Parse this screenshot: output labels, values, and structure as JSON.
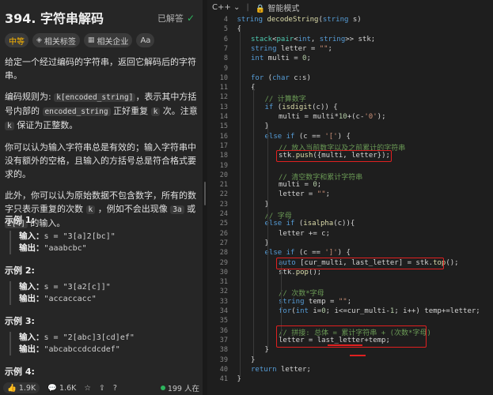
{
  "problem": {
    "title": "394. 字符串解码",
    "solved_label": "已解答",
    "tags": [
      {
        "label": "中等"
      },
      {
        "label": "相关标签"
      },
      {
        "label": "相关企业"
      },
      {
        "label": "Aa"
      }
    ],
    "desc_1": "给定一个经过编码的字符串，返回它解码后的字符串。",
    "desc_2a": "编码规则为: ",
    "desc_2b": "k[encoded_string]",
    "desc_2c": "，表示其中方括号内部的 ",
    "desc_2d": "encoded_string",
    "desc_2e": " 正好重复 ",
    "desc_2f": "k",
    "desc_2g": " 次。注意 ",
    "desc_2h": "k",
    "desc_2i": " 保证为正整数。",
    "desc_3": "你可以认为输入字符串总是有效的；输入字符串中没有额外的空格，且输入的方括号总是符合格式要求的。",
    "desc_4a": "此外，你可以认为原始数据不包含数字，所有的数字只表示重复的次数 ",
    "desc_4b": "k",
    "desc_4c": " ，例如不会出现像 ",
    "desc_4d": "3a",
    "desc_4e": " 或 ",
    "desc_4f": "2[4]",
    "desc_4g": " 的输入。",
    "examples": [
      {
        "title": "示例 1:",
        "input_label": "输入：",
        "input": "s = \"3[a]2[bc]\"",
        "output_label": "输出：",
        "output": "\"aaabcbc\""
      },
      {
        "title": "示例 2:",
        "input_label": "输入：",
        "input": "s = \"3[a2[c]]\"",
        "output_label": "输出：",
        "output": "\"accaccacc\""
      },
      {
        "title": "示例 3:",
        "input_label": "输入：",
        "input": "s = \"2[abc]3[cd]ef\"",
        "output_label": "输出：",
        "output": "\"abcabccdcdcdef\""
      },
      {
        "title": "示例 4:"
      }
    ]
  },
  "bottom": {
    "likes": "1.9K",
    "comments": "1.6K",
    "online": "199 人在"
  },
  "editor": {
    "language": "C++",
    "mode": "智能模式",
    "lines": [
      {
        "n": "4",
        "ind": 1,
        "segs": [
          [
            "k",
            "string "
          ],
          [
            "f",
            "decodeString"
          ],
          [
            "p",
            "("
          ],
          [
            "k",
            "string"
          ],
          [
            "p",
            " s)"
          ]
        ]
      },
      {
        "n": "5",
        "ind": 1,
        "segs": [
          [
            "p",
            "{"
          ]
        ]
      },
      {
        "n": "6",
        "ind": 2,
        "segs": [
          [
            "t",
            "stack"
          ],
          [
            "p",
            "<"
          ],
          [
            "t",
            "pair"
          ],
          [
            "p",
            "<"
          ],
          [
            "k",
            "int"
          ],
          [
            "p",
            ", "
          ],
          [
            "k",
            "string"
          ],
          [
            "p",
            ">> stk;"
          ]
        ]
      },
      {
        "n": "7",
        "ind": 2,
        "segs": [
          [
            "k",
            "string"
          ],
          [
            "p",
            " letter = "
          ],
          [
            "s",
            "\"\""
          ],
          [
            "p",
            ";"
          ]
        ]
      },
      {
        "n": "8",
        "ind": 2,
        "segs": [
          [
            "k",
            "int"
          ],
          [
            "p",
            " multi = "
          ],
          [
            "n",
            "0"
          ],
          [
            "p",
            ";"
          ]
        ]
      },
      {
        "n": "9",
        "ind": 0,
        "segs": []
      },
      {
        "n": "10",
        "ind": 2,
        "segs": [
          [
            "k",
            "for"
          ],
          [
            "p",
            " ("
          ],
          [
            "k",
            "char"
          ],
          [
            "p",
            " c:s)"
          ]
        ]
      },
      {
        "n": "11",
        "ind": 2,
        "segs": [
          [
            "p",
            "{"
          ]
        ]
      },
      {
        "n": "12",
        "ind": 3,
        "segs": [
          [
            "c",
            "// 计算数字"
          ]
        ]
      },
      {
        "n": "13",
        "ind": 3,
        "segs": [
          [
            "k",
            "if"
          ],
          [
            "p",
            " ("
          ],
          [
            "f",
            "isdigit"
          ],
          [
            "p",
            "(c)) {"
          ]
        ]
      },
      {
        "n": "14",
        "ind": 4,
        "segs": [
          [
            "p",
            "multi = multi*"
          ],
          [
            "n",
            "10"
          ],
          [
            "p",
            "+(c-"
          ],
          [
            "s",
            "'0'"
          ],
          [
            "p",
            ");"
          ]
        ]
      },
      {
        "n": "15",
        "ind": 3,
        "segs": [
          [
            "p",
            "}"
          ]
        ]
      },
      {
        "n": "16",
        "ind": 3,
        "segs": [
          [
            "k",
            "else if"
          ],
          [
            "p",
            " (c == "
          ],
          [
            "s",
            "'['"
          ],
          [
            "p",
            ") {"
          ]
        ]
      },
      {
        "n": "17",
        "ind": 4,
        "segs": [
          [
            "c",
            "// 放入当前数字以及之前累计的字符串"
          ]
        ]
      },
      {
        "n": "18",
        "ind": 4,
        "segs": [
          [
            "p",
            "stk."
          ],
          [
            "f",
            "push"
          ],
          [
            "p",
            "({multi, letter});"
          ]
        ]
      },
      {
        "n": "19",
        "ind": 0,
        "segs": []
      },
      {
        "n": "20",
        "ind": 4,
        "segs": [
          [
            "c",
            "// 清空数字和累计字符串"
          ]
        ]
      },
      {
        "n": "21",
        "ind": 4,
        "segs": [
          [
            "p",
            "multi = "
          ],
          [
            "n",
            "0"
          ],
          [
            "p",
            ";"
          ]
        ]
      },
      {
        "n": "22",
        "ind": 4,
        "segs": [
          [
            "p",
            "letter = "
          ],
          [
            "s",
            "\"\""
          ],
          [
            "p",
            ";"
          ]
        ]
      },
      {
        "n": "23",
        "ind": 3,
        "segs": [
          [
            "p",
            "}"
          ]
        ]
      },
      {
        "n": "24",
        "ind": 3,
        "segs": [
          [
            "c",
            "// 字母"
          ]
        ]
      },
      {
        "n": "25",
        "ind": 3,
        "segs": [
          [
            "k",
            "else if"
          ],
          [
            "p",
            " ("
          ],
          [
            "f",
            "isalpha"
          ],
          [
            "p",
            "(c)){"
          ]
        ]
      },
      {
        "n": "26",
        "ind": 4,
        "segs": [
          [
            "p",
            "letter += c;"
          ]
        ]
      },
      {
        "n": "27",
        "ind": 3,
        "segs": [
          [
            "p",
            "}"
          ]
        ]
      },
      {
        "n": "28",
        "ind": 3,
        "segs": [
          [
            "k",
            "else if"
          ],
          [
            "p",
            " (c == "
          ],
          [
            "s",
            "']'"
          ],
          [
            "p",
            ") {"
          ]
        ]
      },
      {
        "n": "29",
        "ind": 4,
        "segs": [
          [
            "k",
            "auto"
          ],
          [
            "p",
            " [cur_multi, last_letter] = stk."
          ],
          [
            "f",
            "top"
          ],
          [
            "p",
            "();"
          ]
        ]
      },
      {
        "n": "30",
        "ind": 4,
        "segs": [
          [
            "p",
            "stk."
          ],
          [
            "f",
            "pop"
          ],
          [
            "p",
            "();"
          ]
        ]
      },
      {
        "n": "31",
        "ind": 0,
        "segs": []
      },
      {
        "n": "32",
        "ind": 4,
        "segs": [
          [
            "c",
            "// 次数*字母"
          ]
        ]
      },
      {
        "n": "33",
        "ind": 4,
        "segs": [
          [
            "k",
            "string"
          ],
          [
            "p",
            " temp = "
          ],
          [
            "s",
            "\"\""
          ],
          [
            "p",
            ";"
          ]
        ]
      },
      {
        "n": "34",
        "ind": 4,
        "segs": [
          [
            "k",
            "for"
          ],
          [
            "p",
            "("
          ],
          [
            "k",
            "int"
          ],
          [
            "p",
            " i="
          ],
          [
            "n",
            "0"
          ],
          [
            "p",
            "; i<=cur_multi-"
          ],
          [
            "n",
            "1"
          ],
          [
            "p",
            "; i++) temp+=letter;"
          ]
        ]
      },
      {
        "n": "35",
        "ind": 0,
        "segs": []
      },
      {
        "n": "36",
        "ind": 4,
        "segs": [
          [
            "c",
            "// 拼接: 总体 = 累计字符串 + (次数*字母)"
          ]
        ]
      },
      {
        "n": "37",
        "ind": 4,
        "segs": [
          [
            "p",
            "letter = last_letter+temp;"
          ]
        ]
      },
      {
        "n": "38",
        "ind": 3,
        "segs": [
          [
            "p",
            "}"
          ]
        ]
      },
      {
        "n": "39",
        "ind": 2,
        "segs": [
          [
            "p",
            "}"
          ]
        ]
      },
      {
        "n": "40",
        "ind": 2,
        "segs": [
          [
            "k",
            "return"
          ],
          [
            "p",
            " letter;"
          ]
        ]
      },
      {
        "n": "41",
        "ind": 1,
        "segs": [
          [
            "p",
            "}"
          ]
        ]
      }
    ]
  }
}
